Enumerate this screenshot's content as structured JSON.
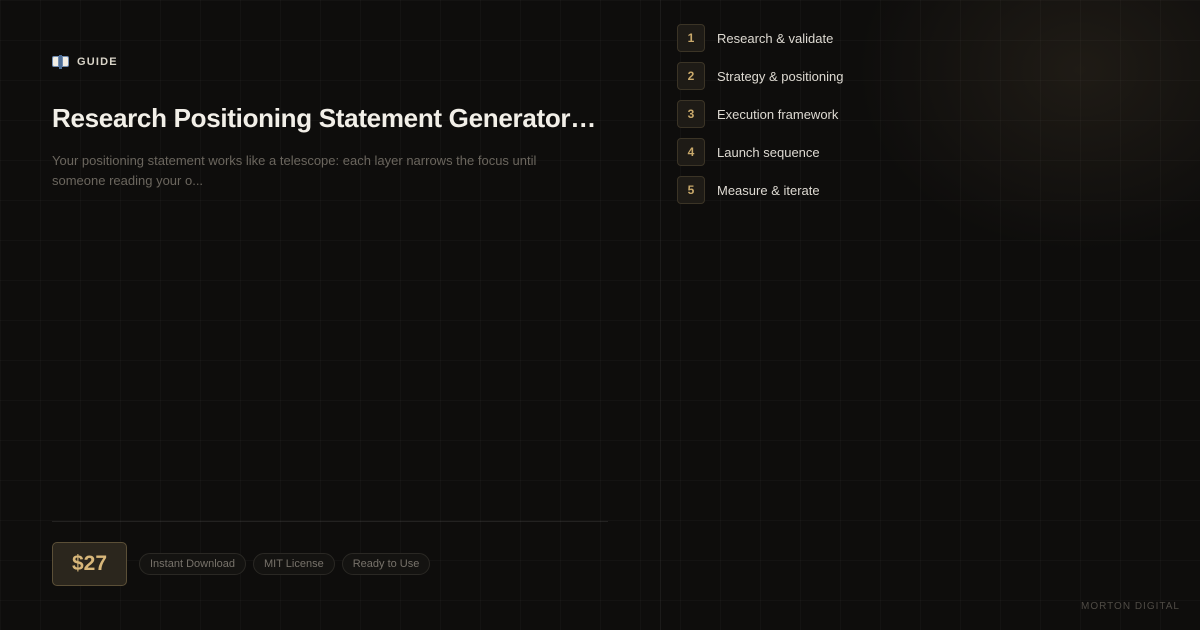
{
  "category": {
    "icon": "open-book-icon",
    "label": "Guide"
  },
  "title": "Research Positioning Statement Generator…",
  "description": "Your positioning statement works like a telescope: each layer narrows the focus until someone reading your o...",
  "price": "$27",
  "badges": [
    "Instant Download",
    "MIT License",
    "Ready to Use"
  ],
  "steps": [
    {
      "number": "1",
      "label": "Research & validate"
    },
    {
      "number": "2",
      "label": "Strategy & positioning"
    },
    {
      "number": "3",
      "label": "Execution framework"
    },
    {
      "number": "4",
      "label": "Launch sequence"
    },
    {
      "number": "5",
      "label": "Measure & iterate"
    }
  ],
  "brand": "Morton Digital",
  "colors": {
    "background": "#0e0d0c",
    "accent": "#d8b77a",
    "title": "#f2efe8",
    "muted_text": "#6b665e"
  }
}
